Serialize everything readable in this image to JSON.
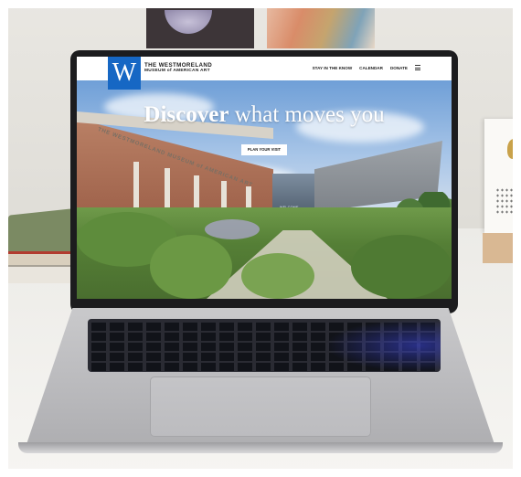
{
  "site": {
    "logo_letter": "W",
    "brand_line1": "THE WESTMORELAND",
    "brand_line2": "MUSEUM of AMERICAN ART",
    "nav": [
      {
        "label": "STAY IN THE KNOW"
      },
      {
        "label": "CALENDAR"
      },
      {
        "label": "DONATE"
      }
    ],
    "menu_icon": "hamburger-menu-icon",
    "hero": {
      "title_strong": "Discover",
      "title_rest": " what moves you",
      "cta_label": "PLAN YOUR VISIT"
    },
    "building_sign": "THE WESTMORELAND MUSEUM of AMERICAN ART",
    "entrance_sign": "WELCOME"
  },
  "colors": {
    "brand_blue": "#1667c4",
    "header_bg": "#ffffff",
    "hero_text": "#ffffff"
  }
}
